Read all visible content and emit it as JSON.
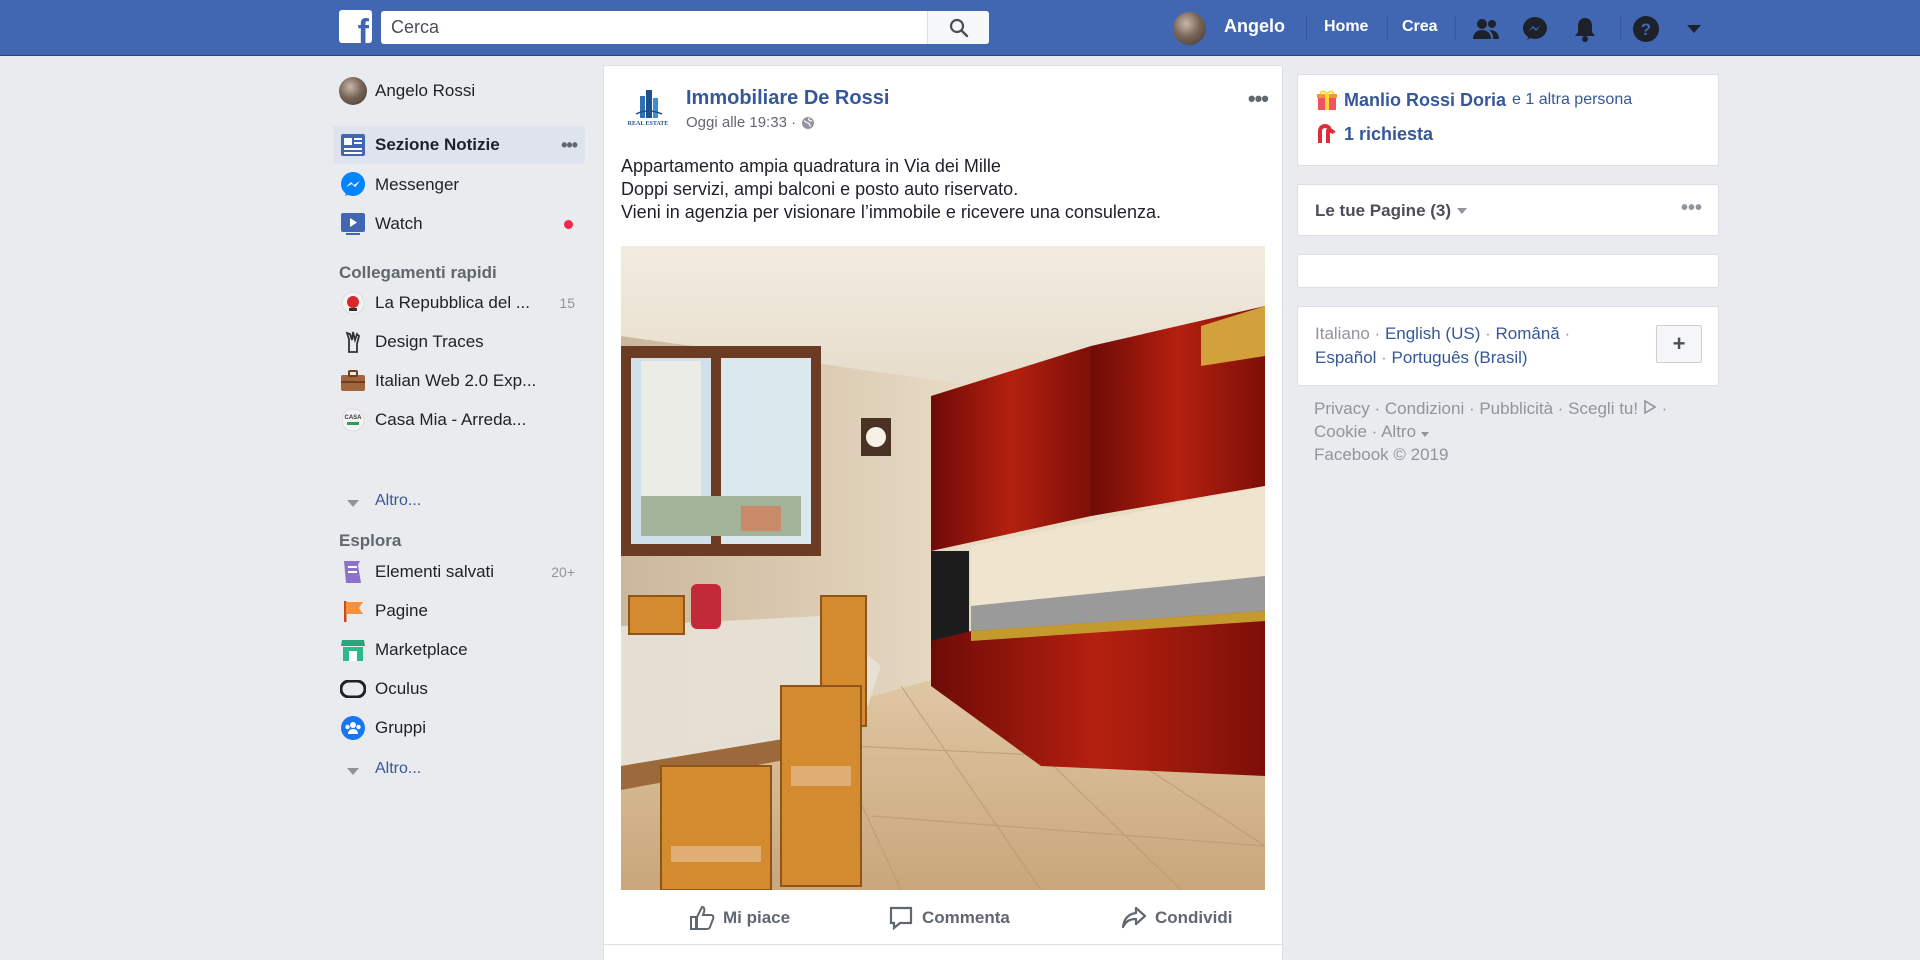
{
  "topbar": {
    "search_placeholder": "Cerca",
    "user_name": "Angelo",
    "home_label": "Home",
    "create_label": "Crea"
  },
  "left": {
    "profile_name": "Angelo Rossi",
    "main_items": [
      {
        "label": "Sezione Notizie",
        "icon": "news-feed-icon"
      },
      {
        "label": "Messenger",
        "icon": "messenger-icon"
      },
      {
        "label": "Watch",
        "icon": "watch-icon"
      }
    ],
    "quick_links_title": "Collegamenti rapidi",
    "quick_links": [
      {
        "label": "La Repubblica del ...",
        "count": "15"
      },
      {
        "label": "Design Traces",
        "count": ""
      },
      {
        "label": "Italian Web 2.0 Exp...",
        "count": ""
      },
      {
        "label": "Casa Mia - Arreda...",
        "count": ""
      }
    ],
    "quick_more": "Altro...",
    "explore_title": "Esplora",
    "explore": [
      {
        "label": "Elementi salvati",
        "count": "20+"
      },
      {
        "label": "Pagine",
        "count": ""
      },
      {
        "label": "Marketplace",
        "count": ""
      },
      {
        "label": "Oculus",
        "count": ""
      },
      {
        "label": "Gruppi",
        "count": ""
      }
    ],
    "explore_more": "Altro..."
  },
  "post": {
    "author": "Immobiliare De Rossi",
    "logo_text": "REAL ESTATE",
    "time": "Oggi alle 19:33 ·",
    "lines": [
      "Appartamento ampia quadratura in Via dei Mille",
      "Doppi servizi, ampi balconi e posto auto riservato.",
      "Vieni in agenzia per visionare l’immobile e ricevere una consulenza."
    ],
    "like": "Mi piace",
    "comment": "Commenta",
    "share": "Condividi"
  },
  "right": {
    "birthday_name": "Manlio Rossi Doria",
    "birthday_other": "e 1 altra persona",
    "requests": "1 richiesta",
    "pages_title": "Le tue Pagine (3)",
    "languages": {
      "italiano": "Italiano",
      "english": "English (US)",
      "romana": "Română",
      "espanol": "Español",
      "portugues": "Português (Brasil)"
    },
    "footer": {
      "privacy": "Privacy",
      "conditions": "Condizioni",
      "ads": "Pubblicità",
      "ad_choices": "Scegli tu!",
      "cookie": "Cookie",
      "more": "Altro",
      "copyright": "Facebook © 2019"
    }
  },
  "colors": {
    "brand": "#4267b2",
    "link": "#365899",
    "background": "#e9ebee",
    "notification_dot": "#f02849"
  }
}
